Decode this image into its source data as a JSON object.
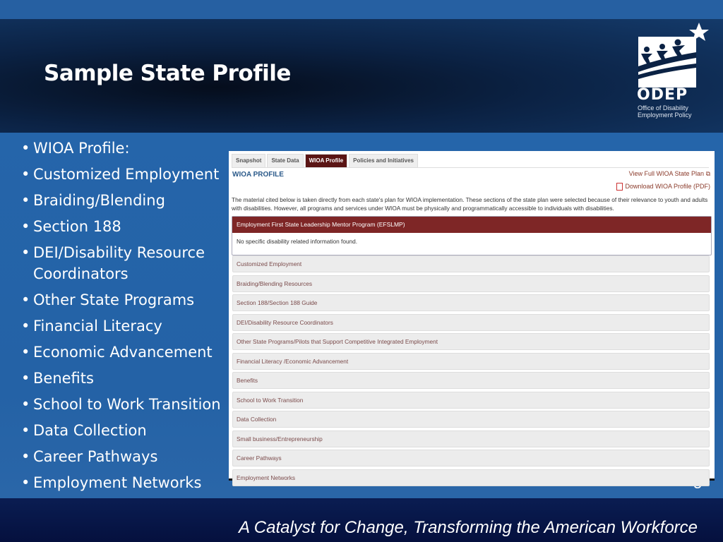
{
  "slide": {
    "title": "Sample State Profile",
    "page_number": "5",
    "tagline": "A Catalyst for Change, Transforming the American Workforce",
    "logo": {
      "word": "ODEP",
      "subtitle": "Office of Disability Employment Policy"
    },
    "bullets": [
      "WIOA Profile:",
      "Customized Employment",
      "Braiding/Blending",
      "Section 188",
      "DEI/Disability Resource Coordinators",
      "Other State Programs",
      "Financial Literacy",
      "Economic Advancement",
      "Benefits",
      "School to Work Transition",
      "Data Collection",
      "Career Pathways",
      "Employment Networks"
    ]
  },
  "screenshot": {
    "tabs": [
      {
        "label": "Snapshot",
        "active": false
      },
      {
        "label": "State Data",
        "active": false
      },
      {
        "label": "WIOA Profile",
        "active": true
      },
      {
        "label": "Policies and Initiatives",
        "active": false
      }
    ],
    "heading": "WIOA PROFILE",
    "view_plan_link": "View Full WIOA State Plan",
    "download_link": "Download WIOA Profile (PDF)",
    "description": "The material cited below is taken directly from each state's plan for WIOA implementation. These sections of the state plan were selected because of their relevance to youth and adults with disabilities. However, all programs and services under WIOA must be physically and programmatically accessible to individuals with disabilities.",
    "open_section": {
      "title": "Employment First State Leadership Mentor Program (EFSLMP)",
      "body": "No specific disability related information found."
    },
    "sections": [
      "Customized Employment",
      "Braiding/Blending Resources",
      "Section 188/Section 188 Guide",
      "DEI/Disability Resource Coordinators",
      "Other State Programs/Pilots that Support Competitive Integrated Employment",
      "Financial Literacy /Economic Advancement",
      "Benefits",
      "School to Work Transition",
      "Data Collection",
      "Small business/Entrepreneurship",
      "Career Pathways",
      "Employment Networks"
    ],
    "colors": {
      "accent": "#7e2626",
      "heading": "#2b5a8a"
    }
  }
}
